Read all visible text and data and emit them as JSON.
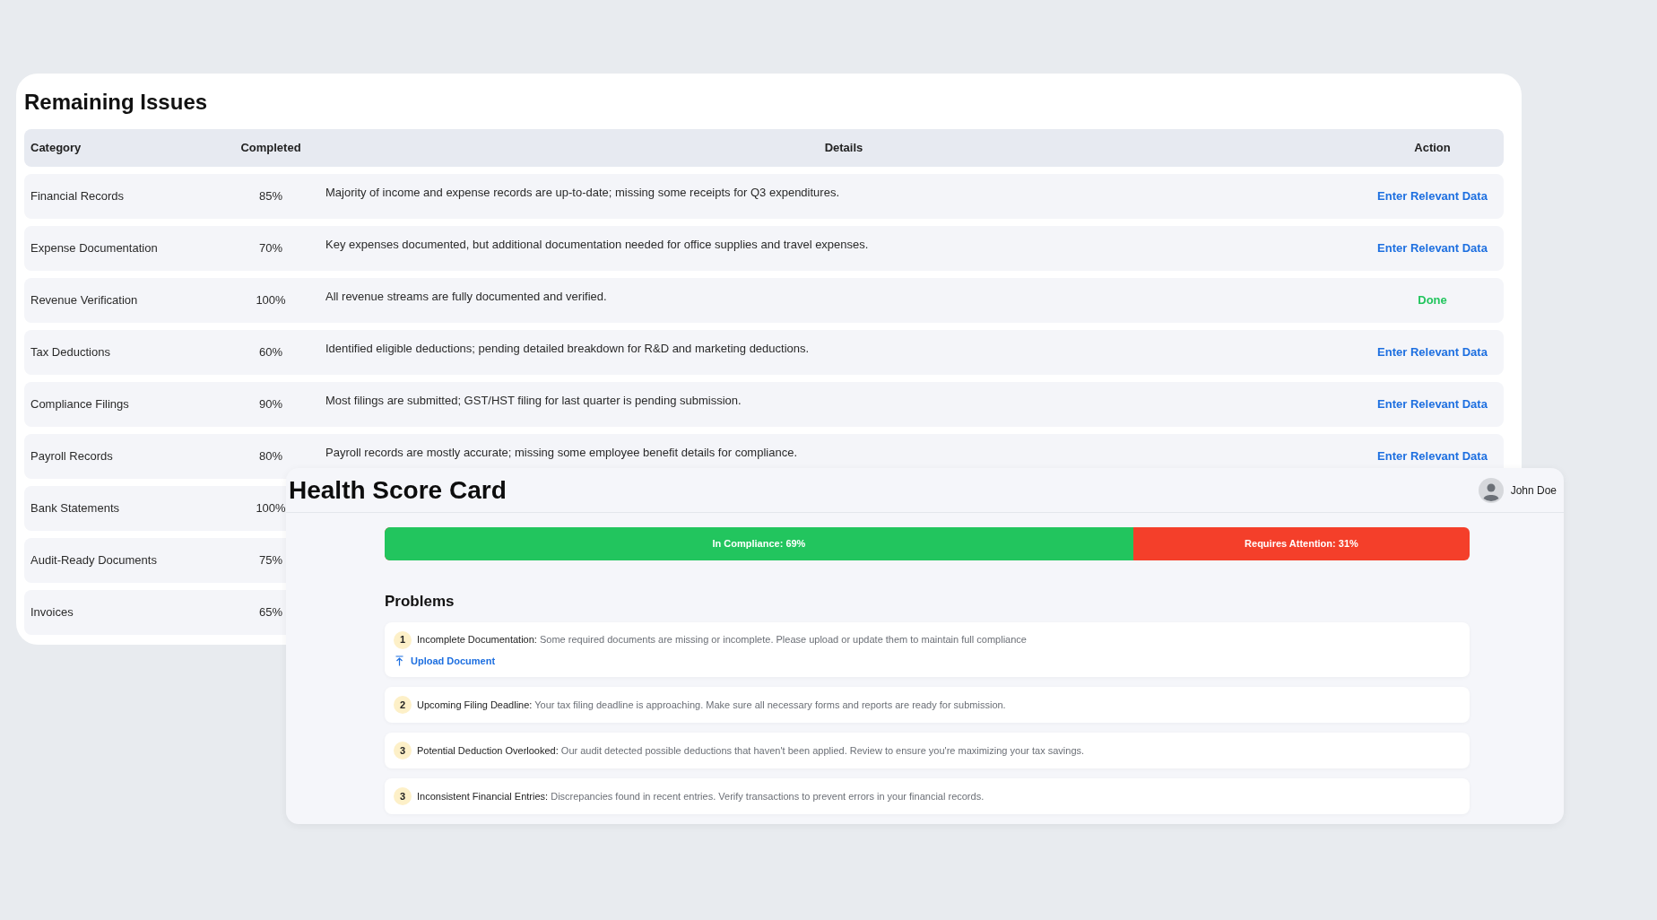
{
  "remaining_issues": {
    "title": "Remaining Issues",
    "columns": [
      "Category",
      "Completed",
      "Details",
      "Action"
    ],
    "rows": [
      {
        "category": "Financial Records",
        "completed": "85%",
        "details": "Majority of income and expense records are up-to-date; missing some receipts for Q3 expenditures.",
        "action": {
          "kind": "link",
          "label": "Enter Relevant Data"
        }
      },
      {
        "category": "Expense Documentation",
        "completed": "70%",
        "details": "Key expenses documented, but additional documentation needed for office supplies and travel expenses.",
        "action": {
          "kind": "link",
          "label": "Enter Relevant Data"
        }
      },
      {
        "category": "Revenue Verification",
        "completed": "100%",
        "details": "All revenue streams are fully documented and verified.",
        "action": {
          "kind": "done",
          "label": "Done"
        }
      },
      {
        "category": "Tax Deductions",
        "completed": "60%",
        "details": "Identified eligible deductions; pending detailed breakdown for R&D and marketing deductions.",
        "action": {
          "kind": "link",
          "label": "Enter Relevant Data"
        }
      },
      {
        "category": "Compliance Filings",
        "completed": "90%",
        "details": "Most filings are submitted; GST/HST filing for last quarter is pending submission.",
        "action": {
          "kind": "link",
          "label": "Enter Relevant Data"
        }
      },
      {
        "category": "Payroll Records",
        "completed": "80%",
        "details": "Payroll records are mostly accurate; missing some employee benefit details for compliance.",
        "action": {
          "kind": "link",
          "label": "Enter Relevant Data"
        }
      },
      {
        "category": "Bank Statements",
        "completed": "100%"
      },
      {
        "category": "Audit-Ready Documents",
        "completed": "75%"
      },
      {
        "category": "Invoices",
        "completed": "65%"
      }
    ]
  },
  "health_score_card": {
    "title": "Health Score Card",
    "user": "John Doe",
    "bar": {
      "level": 0.69,
      "fill_label": "In Compliance: 69%",
      "rest_label": "Requires Attention: 31%"
    },
    "problems_title": "Problems",
    "problems": [
      {
        "number": "1",
        "title": "Incomplete Documentation:",
        "text": "Some required documents are missing or incomplete. Please upload or update them to maintain full compliance",
        "action": "Upload Document"
      },
      {
        "number": "2",
        "title": "Upcoming Filing Deadline:",
        "text": "Your tax filing deadline is approaching. Make sure all necessary forms and reports are ready for submission."
      },
      {
        "number": "3",
        "title": "Potential Deduction Overlooked:",
        "text": "Our audit detected possible deductions that haven't been applied. Review to ensure you're maximizing your tax savings."
      },
      {
        "number": "3",
        "title": "Inconsistent Financial Entries:",
        "text": "Discrepancies found in recent entries. Verify transactions to prevent errors in your financial records."
      }
    ]
  }
}
